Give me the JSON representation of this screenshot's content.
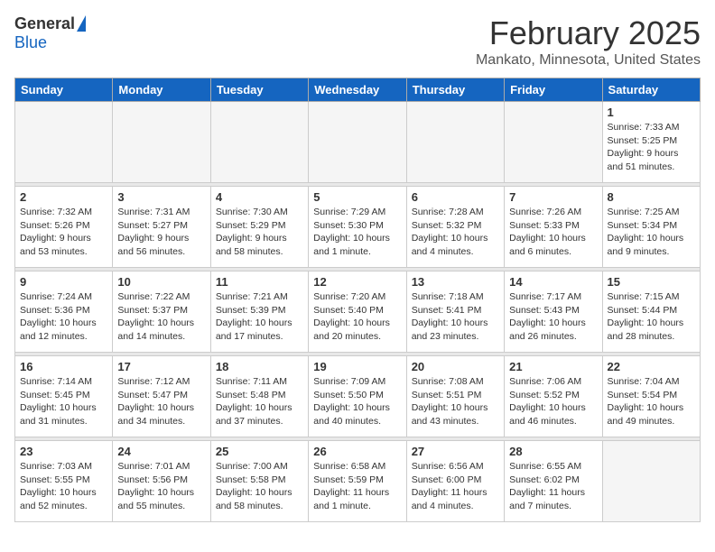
{
  "header": {
    "logo_general": "General",
    "logo_blue": "Blue",
    "month": "February 2025",
    "location": "Mankato, Minnesota, United States"
  },
  "weekdays": [
    "Sunday",
    "Monday",
    "Tuesday",
    "Wednesday",
    "Thursday",
    "Friday",
    "Saturday"
  ],
  "weeks": [
    [
      {
        "day": "",
        "info": ""
      },
      {
        "day": "",
        "info": ""
      },
      {
        "day": "",
        "info": ""
      },
      {
        "day": "",
        "info": ""
      },
      {
        "day": "",
        "info": ""
      },
      {
        "day": "",
        "info": ""
      },
      {
        "day": "1",
        "info": "Sunrise: 7:33 AM\nSunset: 5:25 PM\nDaylight: 9 hours\nand 51 minutes."
      }
    ],
    [
      {
        "day": "2",
        "info": "Sunrise: 7:32 AM\nSunset: 5:26 PM\nDaylight: 9 hours\nand 53 minutes."
      },
      {
        "day": "3",
        "info": "Sunrise: 7:31 AM\nSunset: 5:27 PM\nDaylight: 9 hours\nand 56 minutes."
      },
      {
        "day": "4",
        "info": "Sunrise: 7:30 AM\nSunset: 5:29 PM\nDaylight: 9 hours\nand 58 minutes."
      },
      {
        "day": "5",
        "info": "Sunrise: 7:29 AM\nSunset: 5:30 PM\nDaylight: 10 hours\nand 1 minute."
      },
      {
        "day": "6",
        "info": "Sunrise: 7:28 AM\nSunset: 5:32 PM\nDaylight: 10 hours\nand 4 minutes."
      },
      {
        "day": "7",
        "info": "Sunrise: 7:26 AM\nSunset: 5:33 PM\nDaylight: 10 hours\nand 6 minutes."
      },
      {
        "day": "8",
        "info": "Sunrise: 7:25 AM\nSunset: 5:34 PM\nDaylight: 10 hours\nand 9 minutes."
      }
    ],
    [
      {
        "day": "9",
        "info": "Sunrise: 7:24 AM\nSunset: 5:36 PM\nDaylight: 10 hours\nand 12 minutes."
      },
      {
        "day": "10",
        "info": "Sunrise: 7:22 AM\nSunset: 5:37 PM\nDaylight: 10 hours\nand 14 minutes."
      },
      {
        "day": "11",
        "info": "Sunrise: 7:21 AM\nSunset: 5:39 PM\nDaylight: 10 hours\nand 17 minutes."
      },
      {
        "day": "12",
        "info": "Sunrise: 7:20 AM\nSunset: 5:40 PM\nDaylight: 10 hours\nand 20 minutes."
      },
      {
        "day": "13",
        "info": "Sunrise: 7:18 AM\nSunset: 5:41 PM\nDaylight: 10 hours\nand 23 minutes."
      },
      {
        "day": "14",
        "info": "Sunrise: 7:17 AM\nSunset: 5:43 PM\nDaylight: 10 hours\nand 26 minutes."
      },
      {
        "day": "15",
        "info": "Sunrise: 7:15 AM\nSunset: 5:44 PM\nDaylight: 10 hours\nand 28 minutes."
      }
    ],
    [
      {
        "day": "16",
        "info": "Sunrise: 7:14 AM\nSunset: 5:45 PM\nDaylight: 10 hours\nand 31 minutes."
      },
      {
        "day": "17",
        "info": "Sunrise: 7:12 AM\nSunset: 5:47 PM\nDaylight: 10 hours\nand 34 minutes."
      },
      {
        "day": "18",
        "info": "Sunrise: 7:11 AM\nSunset: 5:48 PM\nDaylight: 10 hours\nand 37 minutes."
      },
      {
        "day": "19",
        "info": "Sunrise: 7:09 AM\nSunset: 5:50 PM\nDaylight: 10 hours\nand 40 minutes."
      },
      {
        "day": "20",
        "info": "Sunrise: 7:08 AM\nSunset: 5:51 PM\nDaylight: 10 hours\nand 43 minutes."
      },
      {
        "day": "21",
        "info": "Sunrise: 7:06 AM\nSunset: 5:52 PM\nDaylight: 10 hours\nand 46 minutes."
      },
      {
        "day": "22",
        "info": "Sunrise: 7:04 AM\nSunset: 5:54 PM\nDaylight: 10 hours\nand 49 minutes."
      }
    ],
    [
      {
        "day": "23",
        "info": "Sunrise: 7:03 AM\nSunset: 5:55 PM\nDaylight: 10 hours\nand 52 minutes."
      },
      {
        "day": "24",
        "info": "Sunrise: 7:01 AM\nSunset: 5:56 PM\nDaylight: 10 hours\nand 55 minutes."
      },
      {
        "day": "25",
        "info": "Sunrise: 7:00 AM\nSunset: 5:58 PM\nDaylight: 10 hours\nand 58 minutes."
      },
      {
        "day": "26",
        "info": "Sunrise: 6:58 AM\nSunset: 5:59 PM\nDaylight: 11 hours\nand 1 minute."
      },
      {
        "day": "27",
        "info": "Sunrise: 6:56 AM\nSunset: 6:00 PM\nDaylight: 11 hours\nand 4 minutes."
      },
      {
        "day": "28",
        "info": "Sunrise: 6:55 AM\nSunset: 6:02 PM\nDaylight: 11 hours\nand 7 minutes."
      },
      {
        "day": "",
        "info": ""
      }
    ]
  ]
}
